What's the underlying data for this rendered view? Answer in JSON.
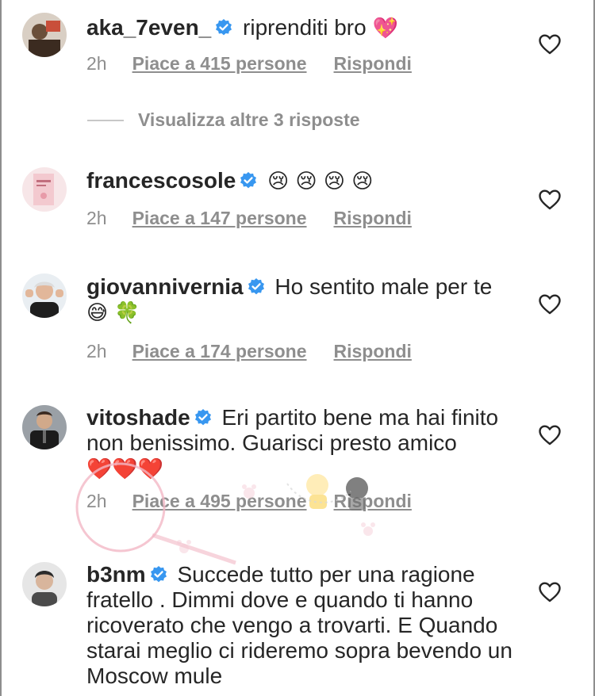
{
  "comments": [
    {
      "username": "aka_7even_",
      "text": "riprenditi bro",
      "emoji": "💖",
      "time": "2h",
      "likes": "Piace a 415 persone",
      "reply": "Rispondi",
      "avatar_color": "#6a4f3a"
    },
    {
      "username": "francescosole",
      "text": "",
      "emoji": "😢 😢 😢 😢",
      "time": "2h",
      "likes": "Piace a 147 persone",
      "reply": "Rispondi",
      "avatar_color": "#f3c9cf"
    },
    {
      "username": "giovannivernia",
      "text": "Ho sentito male per te",
      "emoji": "😅 🍀",
      "time": "2h",
      "likes": "Piace a 174 persone",
      "reply": "Rispondi",
      "avatar_color": "#cfd8e0"
    },
    {
      "username": "vitoshade",
      "text": "Eri partito bene ma hai finito non benissimo. Guarisci presto amico",
      "emoji": "❤️❤️❤️",
      "time": "2h",
      "likes": "Piace a 495 persone",
      "reply": "Rispondi",
      "avatar_color": "#3a3a3a"
    },
    {
      "username": "b3nm",
      "text": "Succede tutto per una ragione fratello . Dimmi dove e quando ti hanno ricoverato che vengo a trovarti. E Quando starai meglio ci rideremo sopra bevendo un Moscow mule",
      "emoji": "",
      "time": "",
      "likes": "",
      "reply": "",
      "avatar_color": "#4b4b4b"
    }
  ],
  "view_more_replies": "Visualizza altre 3 risposte",
  "icons": {
    "verified": "verified-badge-icon",
    "like": "heart-outline-icon"
  },
  "colors": {
    "verified_blue": "#3897f0",
    "secondary_text": "#8e8e8e",
    "primary_text": "#262626",
    "heart_emoji": "#e0245e"
  }
}
